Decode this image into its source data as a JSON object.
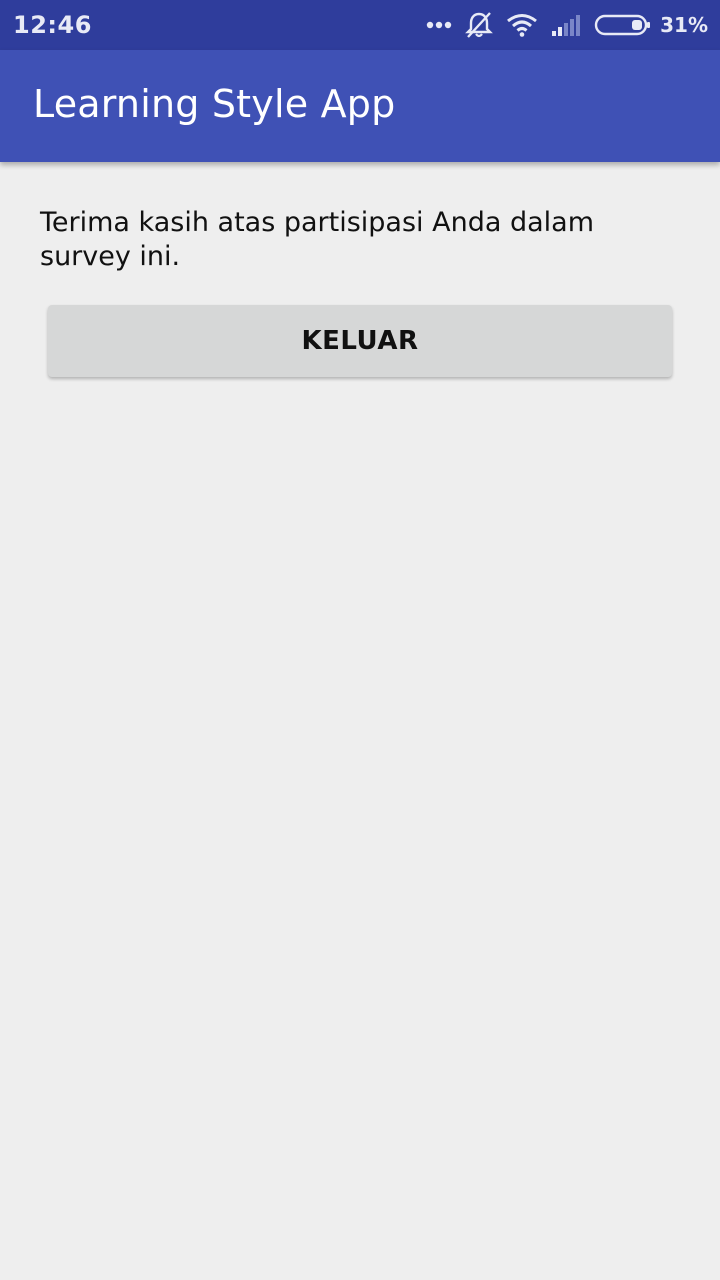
{
  "status_bar": {
    "time": "12:46",
    "icons": [
      "more-dots-icon",
      "silent-bell-icon",
      "wifi-icon",
      "signal-icon",
      "battery-icon"
    ],
    "battery_percent": "31%",
    "battery_level": 0.31
  },
  "app_bar": {
    "title": "Learning Style App",
    "color": "#3f51b5",
    "status_color": "#2f3d9c"
  },
  "main": {
    "message": "Terima kasih atas partisipasi Anda dalam survey ini.",
    "exit_button_label": "KELUAR"
  }
}
